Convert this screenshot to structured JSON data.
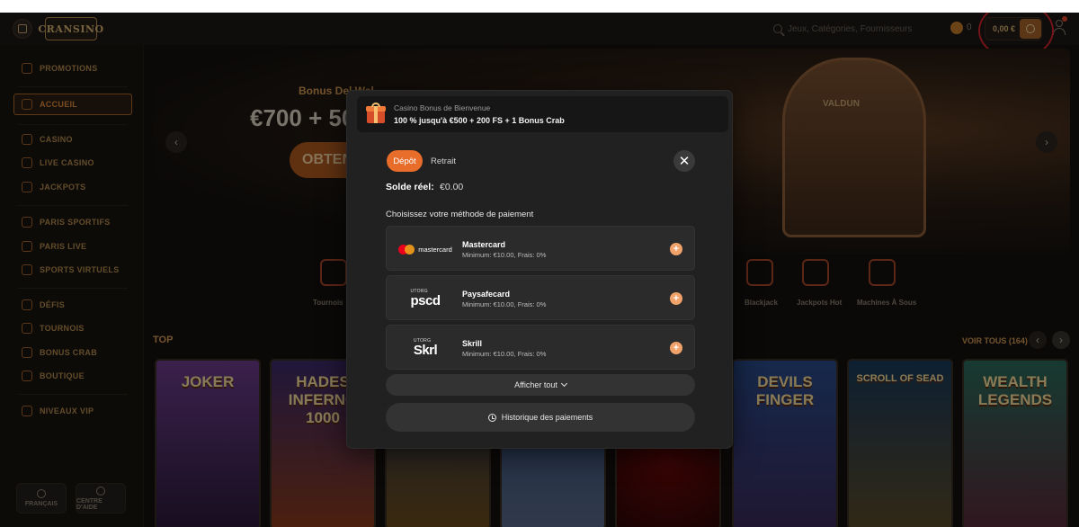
{
  "header": {
    "logo_text": "CRANSINO",
    "search_placeholder": "Jeux, Catégories, Fournisseurs",
    "coin_count": "0",
    "balance": "0,00 €"
  },
  "sidebar": {
    "items": [
      {
        "label": "PROMOTIONS"
      },
      {
        "label": "ACCUEIL"
      },
      {
        "label": "CASINO"
      },
      {
        "label": "LIVE CASINO"
      },
      {
        "label": "JACKPOTS"
      },
      {
        "label": "PARIS SPORTIFS"
      },
      {
        "label": "PARIS LIVE"
      },
      {
        "label": "SPORTS VIRTUELS"
      },
      {
        "label": "DÉFIS"
      },
      {
        "label": "TOURNOIS"
      },
      {
        "label": "BONUS CRAB"
      },
      {
        "label": "BOUTIQUE"
      },
      {
        "label": "NIVEAUX VIP"
      }
    ],
    "language_label": "FRANÇAIS",
    "help_label": "CENTRE D'AIDE"
  },
  "background": {
    "hero_title": "Bonus Del Wel...",
    "hero_amount": "€700 + 50 1",
    "hero_cta": "OBTEN",
    "machine_label": "VALDUN",
    "categories": [
      {
        "label": "Tournois"
      },
      {
        "label": "Blackjack"
      },
      {
        "label": "Jackpots Hot"
      },
      {
        "label": "Machines À Sous"
      }
    ],
    "top_label": "TOP",
    "voir_tous": "VOIR TOUS (164)",
    "games": [
      {
        "title": "JOKER"
      },
      {
        "title": "HADES INFERNO 1000"
      },
      {
        "title": ""
      },
      {
        "title": ""
      },
      {
        "title": ""
      },
      {
        "title": "DEVILS FINGER"
      },
      {
        "title": "SCROLL OF SEAD"
      },
      {
        "title": "WEALTH LEGENDS"
      }
    ]
  },
  "modal": {
    "bonus_kicker": "Casino Bonus de Bienvenue",
    "bonus_text": "100 % jusqu'à €500 + 200 FS + 1 Bonus Crab",
    "tab_depot": "Dépôt",
    "tab_retrait": "Retrait",
    "close_symbol": "✕",
    "solde_label": "Solde réel:",
    "solde_value": "€0.00",
    "choose_label": "Choisissez votre méthode de paiement",
    "methods": [
      {
        "name": "Mastercard",
        "meta": "Minimum: €10.00, Frais: 0%",
        "logo_text": "mastercard"
      },
      {
        "name": "Paysafecard",
        "meta": "Minimum: €10.00, Frais: 0%",
        "logo_small": "UTORG",
        "logo_text": "pscd"
      },
      {
        "name": "Skrill",
        "meta": "Minimum: €10.00, Frais: 0%",
        "logo_small": "UTORG",
        "logo_text": "Skrl"
      }
    ],
    "add_symbol": "+",
    "show_all": "Afficher tout",
    "history": "Historique des paiements"
  },
  "colors": {
    "accent": "#e86d2a",
    "modal_bg": "#212121",
    "annotation": "#d0232a"
  }
}
